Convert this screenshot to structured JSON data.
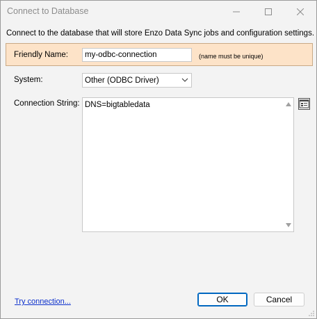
{
  "window": {
    "title": "Connect to Database"
  },
  "intro_text": "Connect to the database that will store Enzo Data Sync jobs and configuration settings.",
  "friendly_name": {
    "label": "Friendly Name:",
    "value": "my-odbc-connection",
    "hint": "(name must be unique)"
  },
  "system": {
    "label": "System:",
    "selected": "Other (ODBC Driver)"
  },
  "connection_string": {
    "label": "Connection String:",
    "value": "DNS=bigtabledata"
  },
  "footer": {
    "try_connection_link": "Try connection...",
    "ok_label": "OK",
    "cancel_label": "Cancel"
  },
  "colors": {
    "highlight_bg": "#fde3c8",
    "link": "#0b2fcc",
    "default_button_border": "#0067c0"
  },
  "icons": {
    "minimize": "minimize-icon",
    "maximize": "maximize-icon",
    "close": "close-icon",
    "dropdown": "chevron-down-icon",
    "builder": "connection-builder-icon"
  }
}
